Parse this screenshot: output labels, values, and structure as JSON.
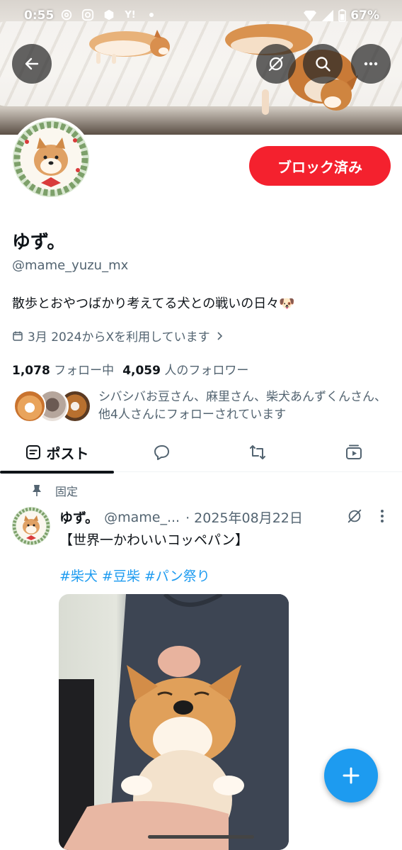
{
  "status_bar": {
    "time": "0:55",
    "battery": "67%",
    "icons": [
      "threads-icon",
      "instagram-icon",
      "app-icon",
      "yahoo-icon",
      "dot-icon"
    ],
    "yahoo_glyph": "Y!"
  },
  "profile": {
    "display_name": "ゆず。",
    "handle": "@mame_yuzu_mx",
    "bio": "散歩とおやつばかり考えてる犬との戦いの日々🐶",
    "joined": "3月 2024からXを利用しています",
    "following_count": "1,078",
    "following_label": "フォロー中",
    "followers_count": "4,059",
    "followers_label": "人のフォロワー",
    "followed_by_text": "シバシバお豆さん、麻里さん、柴犬あんずくんさん、他4人さんにフォローされています",
    "block_button_label": "ブロック済み"
  },
  "tabs": [
    {
      "label": "ポスト",
      "active": true
    },
    {
      "label": "",
      "icon": "reply-icon"
    },
    {
      "label": "",
      "icon": "repost-icon"
    },
    {
      "label": "",
      "icon": "media-icon"
    }
  ],
  "post": {
    "pinned_label": "固定",
    "author_name": "ゆず。",
    "author_handle": "@mame_...",
    "date": "· 2025年08月22日",
    "text": "【世界一かわいいコッペパン】",
    "hashtags": [
      "#柴犬",
      "#豆柴",
      "#パン祭り"
    ]
  },
  "colors": {
    "accent": "#1d9bf0",
    "block_red": "#f4212e",
    "secondary_text": "#536471"
  }
}
